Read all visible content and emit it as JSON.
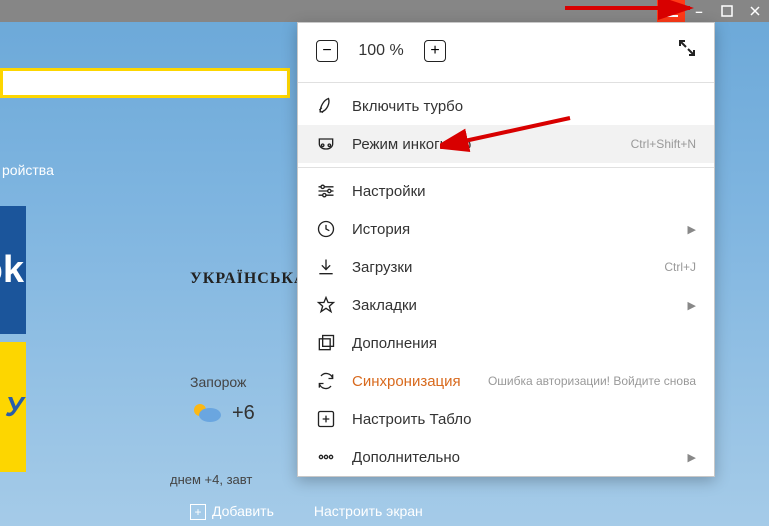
{
  "titlebar": {
    "hamburger": "menu-icon"
  },
  "bg": {
    "devices": "ройства",
    "fb": "ok",
    "news_head": "УКРАЇНСЬКА",
    "yellow": "У",
    "weather_city": "Запорож",
    "temp": "+6",
    "forecast": "днем +4, завт",
    "add_btn": "Добавить",
    "customize_btn": "Настроить экран"
  },
  "menu": {
    "zoom_value": "100 %",
    "items": [
      {
        "label": "Включить турбо"
      },
      {
        "label": "Режим инкогнито",
        "hint": "Ctrl+Shift+N",
        "highlight": true
      },
      {
        "label": "Настройки"
      },
      {
        "label": "История",
        "sub": true
      },
      {
        "label": "Загрузки",
        "hint": "Ctrl+J"
      },
      {
        "label": "Закладки",
        "sub": true
      },
      {
        "label": "Дополнения"
      },
      {
        "label": "Синхронизация",
        "hint": "Ошибка авторизации! Войдите снова",
        "sync": true
      },
      {
        "label": "Настроить Табло"
      },
      {
        "label": "Дополнительно",
        "sub": true
      }
    ]
  }
}
